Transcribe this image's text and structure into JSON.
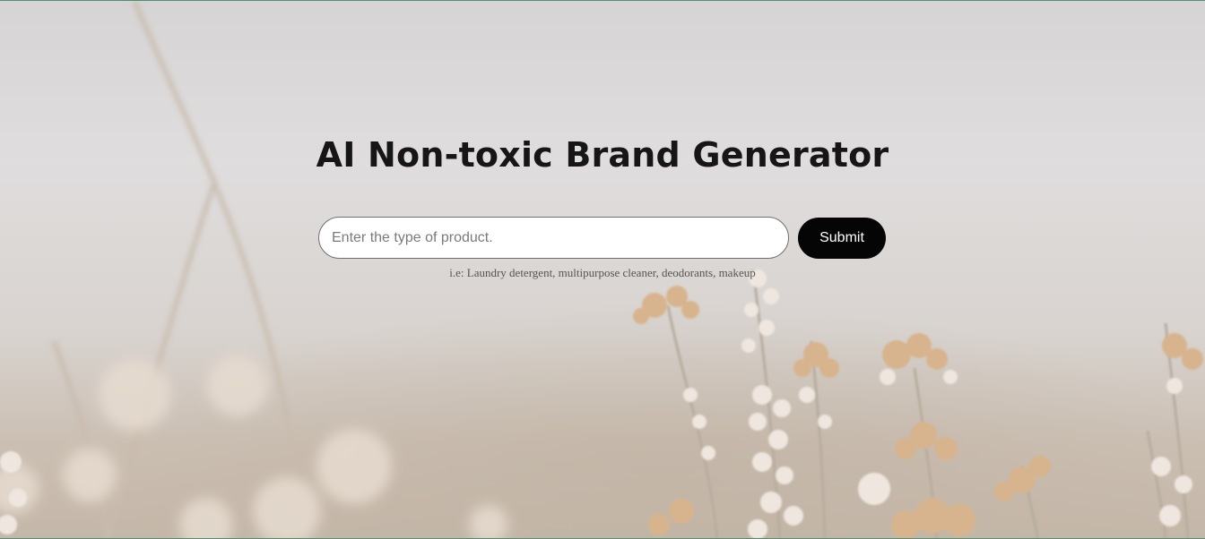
{
  "header": {
    "title": "AI Non-toxic Brand Generator"
  },
  "search": {
    "placeholder": "Enter the type of product.",
    "value": ""
  },
  "submit": {
    "label": "Submit"
  },
  "hint": {
    "text": "i.e: Laundry detergent, multipurpose cleaner, deodorants, makeup"
  },
  "colors": {
    "button_bg": "#050505",
    "button_text": "#ffffff",
    "title": "#161616",
    "accent_border": "#4f8f74"
  }
}
